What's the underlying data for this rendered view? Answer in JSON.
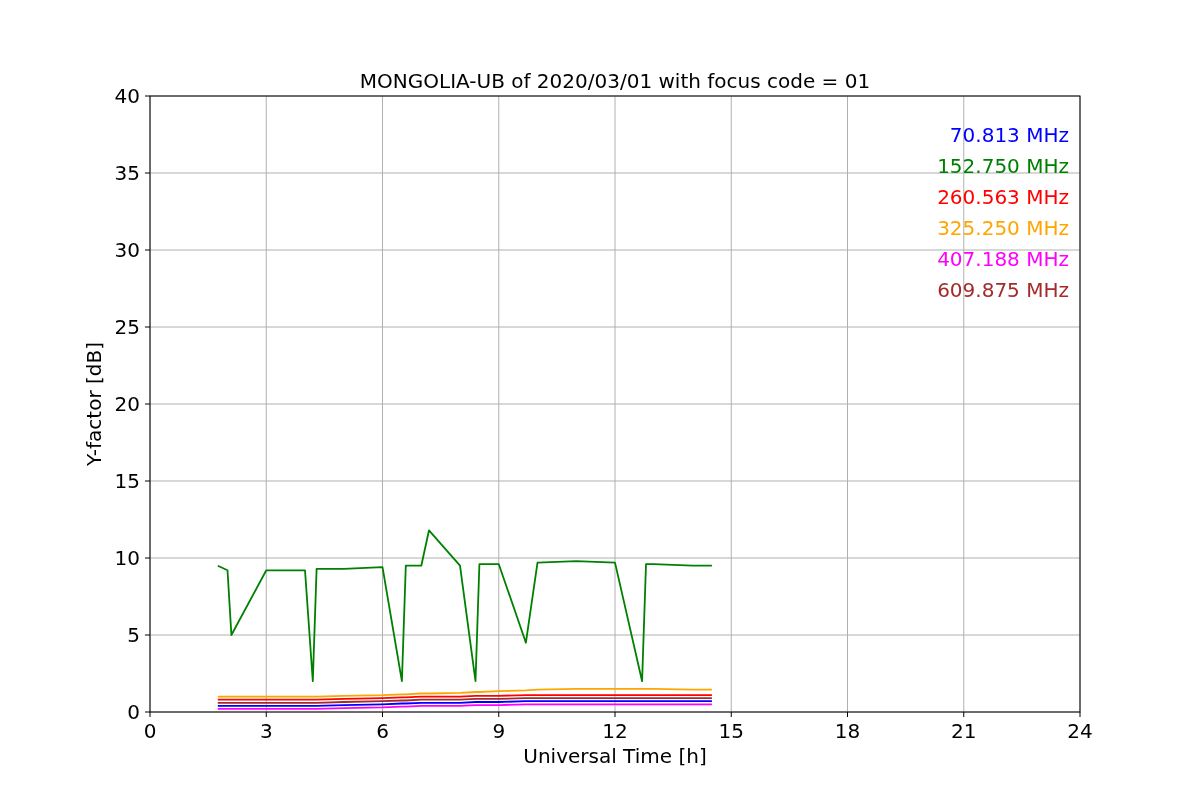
{
  "chart_data": {
    "type": "line",
    "title": "MONGOLIA-UB of 2020/03/01 with focus code = 01",
    "xlabel": "Universal Time [h]",
    "ylabel": "Y-factor [dB]",
    "x": [
      1.75,
      2,
      2.1,
      3,
      4,
      4.2,
      4.3,
      5,
      6,
      6.5,
      6.6,
      7,
      7.2,
      8,
      8.4,
      8.5,
      9,
      9.7,
      10,
      11,
      12,
      12.7,
      12.8,
      13,
      14,
      14.5
    ],
    "series": [
      {
        "name": "70.813 MHz",
        "color": "#0000ff",
        "values": [
          0.4,
          0.4,
          0.4,
          0.4,
          0.4,
          0.4,
          0.4,
          0.45,
          0.5,
          0.55,
          0.55,
          0.6,
          0.6,
          0.6,
          0.65,
          0.65,
          0.65,
          0.7,
          0.7,
          0.7,
          0.7,
          0.7,
          0.7,
          0.7,
          0.7,
          0.7
        ]
      },
      {
        "name": "152.750 MHz",
        "color": "#008000",
        "values": [
          9.5,
          9.2,
          5,
          9.2,
          9.2,
          2,
          9.3,
          9.3,
          9.4,
          2,
          9.5,
          9.5,
          11.8,
          9.5,
          2,
          9.6,
          9.6,
          4.5,
          9.7,
          9.8,
          9.7,
          2,
          9.6,
          9.6,
          9.5,
          9.5
        ]
      },
      {
        "name": "260.563 MHz",
        "color": "#ff0000",
        "values": [
          0.8,
          0.8,
          0.8,
          0.8,
          0.8,
          0.8,
          0.8,
          0.85,
          0.9,
          0.95,
          0.95,
          1.0,
          1.0,
          1.0,
          1.05,
          1.05,
          1.05,
          1.1,
          1.1,
          1.1,
          1.1,
          1.1,
          1.1,
          1.1,
          1.1,
          1.1
        ]
      },
      {
        "name": "325.250 MHz",
        "color": "#ffa500",
        "values": [
          1.0,
          1.0,
          1.0,
          1.0,
          1.0,
          1.0,
          1.0,
          1.05,
          1.1,
          1.15,
          1.15,
          1.2,
          1.2,
          1.25,
          1.3,
          1.3,
          1.35,
          1.4,
          1.45,
          1.5,
          1.5,
          1.5,
          1.5,
          1.5,
          1.45,
          1.45
        ]
      },
      {
        "name": "407.188 MHz",
        "color": "#ff00ff",
        "values": [
          0.2,
          0.2,
          0.2,
          0.2,
          0.2,
          0.2,
          0.2,
          0.25,
          0.3,
          0.35,
          0.35,
          0.4,
          0.4,
          0.4,
          0.45,
          0.45,
          0.45,
          0.5,
          0.5,
          0.5,
          0.5,
          0.5,
          0.5,
          0.5,
          0.5,
          0.5
        ]
      },
      {
        "name": "609.875 MHz",
        "color": "#a52a2a",
        "values": [
          0.6,
          0.6,
          0.6,
          0.6,
          0.6,
          0.6,
          0.6,
          0.65,
          0.7,
          0.75,
          0.75,
          0.8,
          0.8,
          0.8,
          0.85,
          0.85,
          0.85,
          0.9,
          0.9,
          0.9,
          0.9,
          0.9,
          0.9,
          0.9,
          0.9,
          0.9
        ]
      }
    ],
    "xlim": [
      0,
      24
    ],
    "ylim": [
      0,
      40
    ],
    "xticks": [
      0,
      3,
      6,
      9,
      12,
      15,
      18,
      21,
      24
    ],
    "yticks": [
      0,
      5,
      10,
      15,
      20,
      25,
      30,
      35,
      40
    ],
    "grid": true
  }
}
